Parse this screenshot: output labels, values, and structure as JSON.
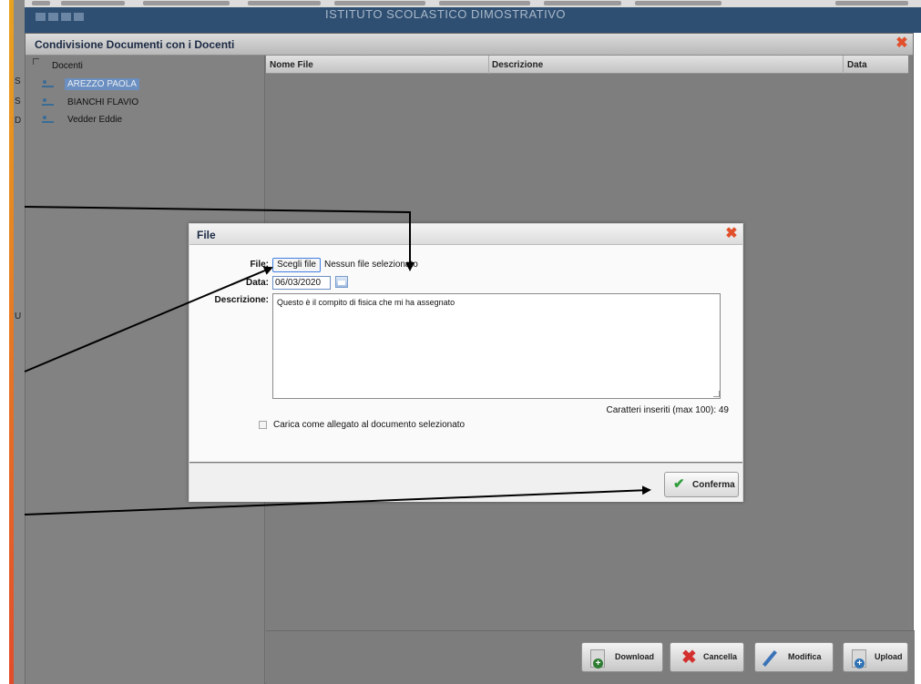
{
  "banner": {
    "title": "ISTITUTO SCOLASTICO DIMOSTRATIVO"
  },
  "window": {
    "title": "Condivisione Documenti con i Docenti",
    "close_glyph": "✖"
  },
  "side_letters": [
    "S",
    "S",
    "D",
    "U"
  ],
  "tree": {
    "root_label": "Docenti",
    "items": [
      {
        "label": "AREZZO PAOLA",
        "selected": true
      },
      {
        "label": "BIANCHI FLAVIO",
        "selected": false
      },
      {
        "label": "Vedder Eddie",
        "selected": false
      }
    ]
  },
  "grid": {
    "columns": [
      "Nome File",
      "Descrizione",
      "Data"
    ]
  },
  "toolbar": {
    "download_label": "Download",
    "delete_label": "Cancella",
    "edit_label": "Modifica",
    "upload_label": "Upload"
  },
  "dialog": {
    "title": "File",
    "close_glyph": "✖",
    "file_label": "File:",
    "choose_file_label": "Scegli file",
    "file_status": "Nessun file selezionato",
    "date_label": "Data:",
    "date_value": "06/03/2020",
    "description_label": "Descrizione:",
    "description_value": "Questo è il compito di fisica che mi ha assegnato",
    "char_counter": "Caratteri inseriti (max 100): 49",
    "attach_label": "Carica come allegato al documento selezionato",
    "confirm_label": "Conferma"
  },
  "icons": {
    "check": "✔",
    "delete": "✖",
    "plus": "+"
  },
  "colors": {
    "selection": "#6b8fc0",
    "close_red": "#e2502c",
    "confirm_green": "#2e9e3a",
    "focus_blue": "#3f7fe4"
  }
}
